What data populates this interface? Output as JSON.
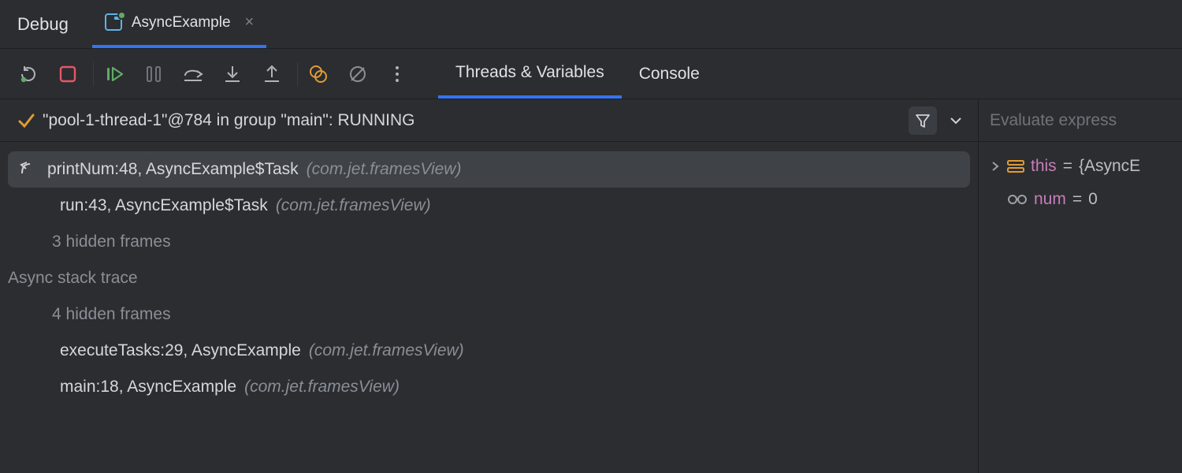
{
  "panel": {
    "title": "Debug",
    "tab": {
      "label": "AsyncExample"
    }
  },
  "toolbar": {
    "rerun": "rerun-icon",
    "stop": "stop-icon",
    "resume": "resume-icon",
    "pause": "pause-icon",
    "step_over": "step-over-icon",
    "step_into": "step-into-icon",
    "step_out": "step-out-icon",
    "view_breakpoints": "view-breakpoints-icon",
    "mute_breakpoints": "mute-breakpoints-icon",
    "more": "more-icon"
  },
  "subtabs": {
    "threads": "Threads & Variables",
    "console": "Console",
    "active": "threads"
  },
  "thread": {
    "label": "\"pool-1-thread-1\"@784 in group \"main\": RUNNING"
  },
  "frames": [
    {
      "kind": "frame",
      "selected": true,
      "drop": true,
      "method": "printNum:48, AsyncExample$Task",
      "pkg": "(com.jet.framesView)"
    },
    {
      "kind": "frame",
      "selected": false,
      "drop": false,
      "method": "run:43, AsyncExample$Task",
      "pkg": "(com.jet.framesView)"
    },
    {
      "kind": "muted",
      "text": "3 hidden frames"
    },
    {
      "kind": "section",
      "text": "Async stack trace"
    },
    {
      "kind": "muted",
      "text": "4 hidden frames"
    },
    {
      "kind": "frame",
      "selected": false,
      "drop": false,
      "method": "executeTasks:29, AsyncExample",
      "pkg": "(com.jet.framesView)"
    },
    {
      "kind": "frame",
      "selected": false,
      "drop": false,
      "method": "main:18, AsyncExample",
      "pkg": "(com.jet.framesView)"
    }
  ],
  "vars": {
    "placeholder": "Evaluate express",
    "rows": [
      {
        "icon": "object-icon",
        "expand": true,
        "name": "this",
        "value": "{AsyncE"
      },
      {
        "icon": "glasses-icon",
        "expand": false,
        "name": "num",
        "value": "0"
      }
    ]
  }
}
